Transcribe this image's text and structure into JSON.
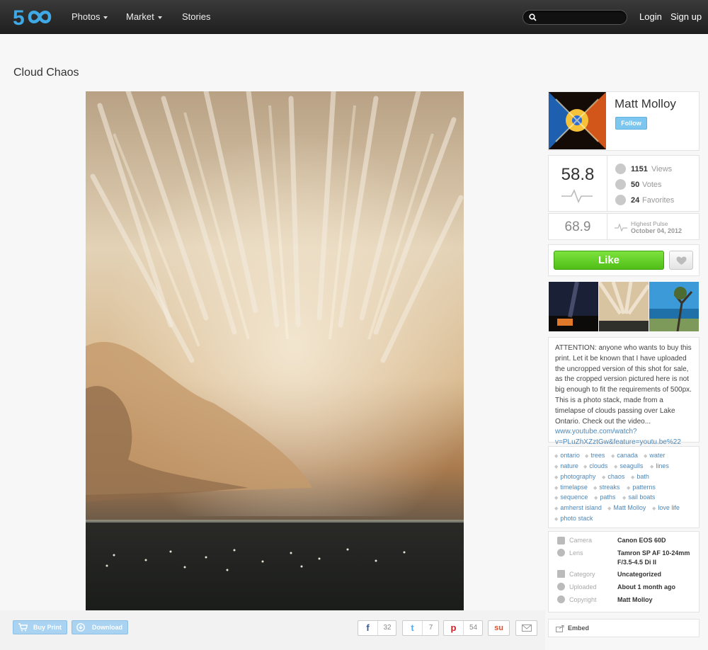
{
  "nav": {
    "logo_text": "500",
    "items": [
      {
        "label": "Photos",
        "has_menu": true
      },
      {
        "label": "Market",
        "has_menu": true
      },
      {
        "label": "Stories",
        "has_menu": false
      }
    ],
    "search": {
      "value": "",
      "placeholder": ""
    },
    "login": "Login",
    "signup": "Sign up"
  },
  "photo": {
    "title": "Cloud Chaos"
  },
  "actions": {
    "buy_print": "Buy Print",
    "download": "Download",
    "shares": [
      {
        "network": "facebook",
        "icon": "f",
        "count": "32"
      },
      {
        "network": "twitter",
        "icon": "t",
        "count": "7"
      },
      {
        "network": "pinterest",
        "icon": "p",
        "count": "54"
      },
      {
        "network": "stumbleupon",
        "icon": "su",
        "count": ""
      },
      {
        "network": "email",
        "icon": "envelope",
        "count": ""
      }
    ]
  },
  "author": {
    "name": "Matt Molloy",
    "follow_label": "Follow"
  },
  "stats": {
    "pulse": "58.8",
    "highest_pulse": "68.9",
    "highest_pulse_label": "Highest Pulse",
    "highest_pulse_date": "October 04, 2012",
    "views_count": "1151",
    "views_label": "Views",
    "votes_count": "50",
    "votes_label": "Votes",
    "favorites_count": "24",
    "favorites_label": "Favorites"
  },
  "like_label": "Like",
  "description": {
    "text": "ATTENTION: anyone who wants to buy this print. Let it be known that I have uploaded the uncropped version of this shot for sale, as the cropped version pictured here is not big enough to fit the requirements of 500px. This is a photo stack, made from a timelapse of clouds passing over Lake Ontario. Check out the video... ",
    "link": "www.youtube.com/watch?v=PLuZhXZztGw&feature=youtu.be%22"
  },
  "tags": [
    "ontario",
    "trees",
    "canada",
    "water",
    "nature",
    "clouds",
    "seagulls",
    "lines",
    "photography",
    "chaos",
    "bath",
    "timelapse",
    "streaks",
    "patterns",
    "sequence",
    "paths",
    "sail boats",
    "amherst island",
    "Matt Molloy",
    "love life",
    "photo stack"
  ],
  "meta": {
    "camera_label": "Camera",
    "camera": "Canon EOS 60D",
    "lens_label": "Lens",
    "lens": "Tamron SP AF 10-24mm F/3.5-4.5 Di II",
    "category_label": "Category",
    "category": "Uncategorized",
    "uploaded_label": "Uploaded",
    "uploaded": "About 1 month ago",
    "copyright_label": "Copyright",
    "copyright": "Matt Molloy"
  },
  "embed_label": "Embed",
  "colors": {
    "brand_blue": "#3fa9e6",
    "like_green": "#5ccc22",
    "link": "#4d87b8"
  }
}
